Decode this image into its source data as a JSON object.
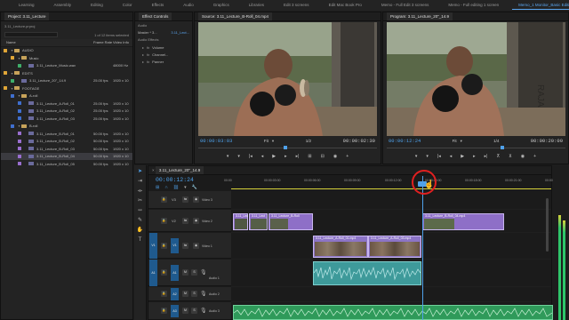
{
  "workspace_tabs": [
    {
      "label": "Learning",
      "active": false
    },
    {
      "label": "Assembly",
      "active": false
    },
    {
      "label": "Editing",
      "active": false
    },
    {
      "label": "Color",
      "active": false
    },
    {
      "label": "Effects",
      "active": false
    },
    {
      "label": "Audio",
      "active": false
    },
    {
      "label": "Graphics",
      "active": false
    },
    {
      "label": "Libraries",
      "active": false
    },
    {
      "label": "Edit 3 screens",
      "active": false
    },
    {
      "label": "Edit Mac Book Pro",
      "active": false
    },
    {
      "label": "Memo - Full Edit 3 screens",
      "active": false
    },
    {
      "label": "Memo - Full editing 1 screen",
      "active": false
    },
    {
      "label": "Memo_1 Monitor_Basic Editing",
      "active": true
    }
  ],
  "project": {
    "title": "Project: 3.11_Lecture",
    "file": "3.11_Lecture.prproj",
    "count": "1 of 12 items selected",
    "col_name": "Name",
    "col_fps": "Frame Rate",
    "col_media": "Video Info",
    "rows": [
      {
        "indent": 0,
        "kind": "folder",
        "twirl": "▾",
        "chip": "#e0a637",
        "name": "AUDIO",
        "fps": "",
        "media": "",
        "sel": false
      },
      {
        "indent": 1,
        "kind": "folder",
        "twirl": "▾",
        "chip": "#e0a637",
        "name": "Music",
        "fps": "",
        "media": "",
        "sel": false
      },
      {
        "indent": 2,
        "kind": "clip",
        "twirl": "",
        "chip": "#3fae6a",
        "name": "3.11_Lecture_Music.wav",
        "fps": "",
        "media": "48000 Hz",
        "sel": false
      },
      {
        "indent": 0,
        "kind": "folder",
        "twirl": "▾",
        "chip": "#e0a637",
        "name": "EDITS",
        "fps": "",
        "media": "",
        "sel": false
      },
      {
        "indent": 1,
        "kind": "clip",
        "twirl": "",
        "chip": "#3fae6a",
        "name": "3.11_Lecture_20\"_14.9",
        "fps": "25.00 fps",
        "media": "1920 x 10",
        "sel": false
      },
      {
        "indent": 0,
        "kind": "folder",
        "twirl": "▾",
        "chip": "#e0a637",
        "name": "FOOTAGE",
        "fps": "",
        "media": "",
        "sel": false
      },
      {
        "indent": 1,
        "kind": "folder",
        "twirl": "▾",
        "chip": "#3f6fcf",
        "name": "A-roll",
        "fps": "",
        "media": "",
        "sel": false
      },
      {
        "indent": 2,
        "kind": "clip",
        "twirl": "",
        "chip": "#3f6fcf",
        "name": "3.11_Lecture_A-Roll_01",
        "fps": "25.00 fps",
        "media": "1920 x 10",
        "sel": false
      },
      {
        "indent": 2,
        "kind": "clip",
        "twirl": "",
        "chip": "#3f6fcf",
        "name": "3.11_Lecture_A-Roll_02",
        "fps": "25.00 fps",
        "media": "1920 x 10",
        "sel": false
      },
      {
        "indent": 2,
        "kind": "clip",
        "twirl": "",
        "chip": "#3f6fcf",
        "name": "3.11_Lecture_A-Roll_03",
        "fps": "25.00 fps",
        "media": "1920 x 10",
        "sel": false
      },
      {
        "indent": 1,
        "kind": "folder",
        "twirl": "▾",
        "chip": "#3f6fcf",
        "name": "B-roll",
        "fps": "",
        "media": "",
        "sel": false
      },
      {
        "indent": 2,
        "kind": "clip",
        "twirl": "",
        "chip": "#9a6fd0",
        "name": "3.11_Lecture_B-Roll_01",
        "fps": "50.00 fps",
        "media": "1920 x 10",
        "sel": false
      },
      {
        "indent": 2,
        "kind": "clip",
        "twirl": "",
        "chip": "#9a6fd0",
        "name": "3.11_Lecture_B-Roll_02",
        "fps": "50.00 fps",
        "media": "1920 x 10",
        "sel": false
      },
      {
        "indent": 2,
        "kind": "clip",
        "twirl": "",
        "chip": "#9a6fd0",
        "name": "3.11_Lecture_B-Roll_03",
        "fps": "50.00 fps",
        "media": "1920 x 10",
        "sel": false
      },
      {
        "indent": 2,
        "kind": "clip",
        "twirl": "",
        "chip": "#9a6fd0",
        "name": "3.11_Lecture_B-Roll_04",
        "fps": "50.00 fps",
        "media": "1920 x 10",
        "sel": true
      },
      {
        "indent": 2,
        "kind": "clip",
        "twirl": "",
        "chip": "#9a6fd0",
        "name": "3.11_Lecture_B-Roll_05",
        "fps": "50.00 fps",
        "media": "1920 x 10",
        "sel": false
      }
    ]
  },
  "effects": {
    "tab1": "Effect Controls",
    "tab2": "Audio",
    "master": "Master * 3...",
    "seq": "3.11_Lect...",
    "section": "Audio Effects",
    "items": [
      "Volume",
      "Channel...",
      "Panner"
    ]
  },
  "source": {
    "title": "Source: 3.11_Lecture_B-Roll_04.mp4",
    "tc_left": "00:00:03:03",
    "fit": "Fit",
    "ratio": "1/2",
    "tc_right": "00:00:02:30"
  },
  "program": {
    "title": "Program: 3.11_Lecture_20\"_14.9",
    "tc_left": "00:00:12:24",
    "fit": "Fit",
    "ratio": "1/4",
    "tc_right": "00:00:20:00"
  },
  "timeline": {
    "tab": "3.11_Lecture_20\"_14.9",
    "timecode": "00:00:12:24",
    "ruler": [
      "00:00",
      "00:00:03:00",
      "00:00:06:00",
      "00:00:09:00",
      "00:00:12:00",
      "00:00:15:00",
      "00:00:18:00",
      "00:00:21:00",
      "00:00:24:00"
    ],
    "tracks": {
      "v3": "V3",
      "v2": "V2",
      "v1": "V1",
      "a1": "A1",
      "a2": "A2",
      "a3": "A3",
      "video3": "Video 3",
      "video2": "Video 2",
      "video1": "Video 1",
      "audio1": "Audio 1",
      "audio2": "Audio 2",
      "audio3": "Audio 3",
      "src_v": "V1",
      "src_a": "A1"
    },
    "clips_v2": [
      "3.11_Lec",
      "3.11_Lect",
      "3.11_Lecture_B-Roll",
      "3.11_Lecture_B-Roll_04.mp4"
    ],
    "clips_v1": [
      "3.11_Lecture_A-Roll_01.mp4",
      "3.11_Lecture_A-Roll_03.mp4"
    ]
  },
  "colors": {
    "accent": "#4fa1ea",
    "video_clip": "#8e6fc7",
    "audio_clip": "#3e9a9a",
    "music_clip": "#2f9a5a",
    "cursor_circle": "#e02020"
  }
}
